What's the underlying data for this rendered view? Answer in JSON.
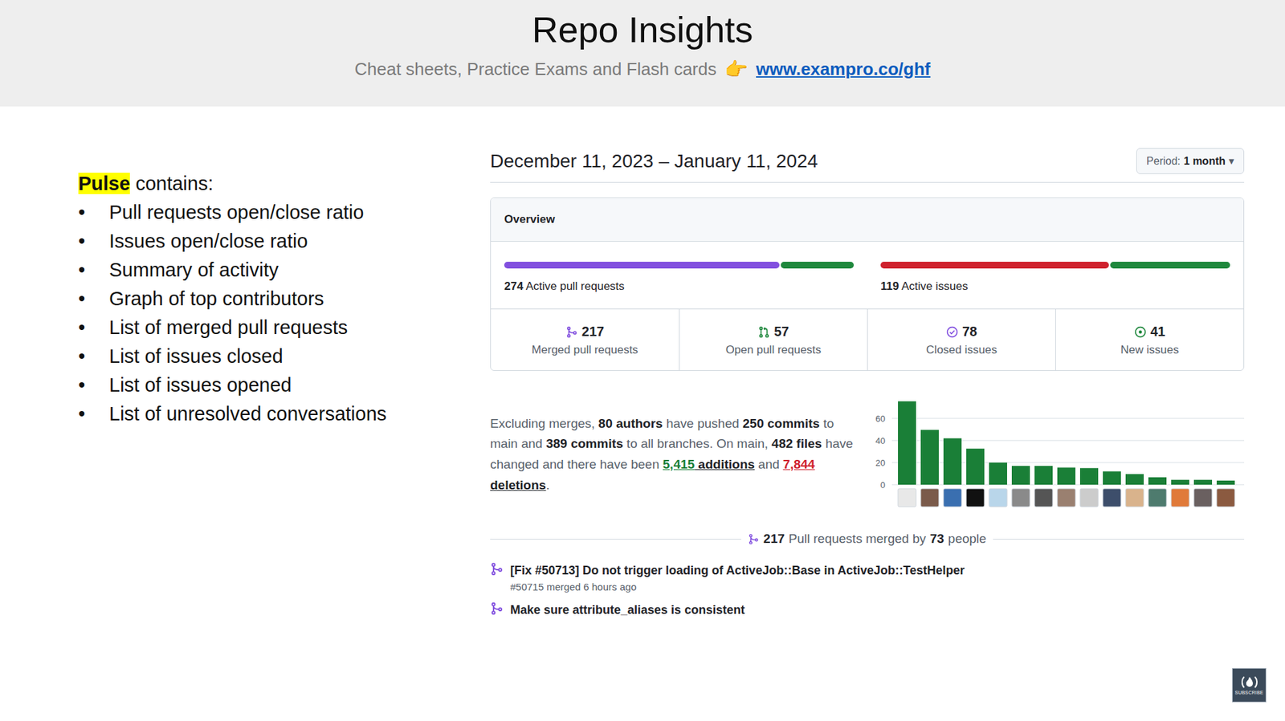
{
  "slide": {
    "title": "Repo Insights",
    "subtitle": "Cheat sheets, Practice Exams and Flash cards",
    "pointer": "👉",
    "link": "www.exampro.co/ghf"
  },
  "notes": {
    "highlight": "Pulse",
    "heading": " contains:",
    "bullet": "•",
    "items": [
      "Pull requests open/close ratio",
      "Issues open/close ratio",
      "Summary of activity",
      "Graph of top contributors",
      "List of merged pull requests",
      "List of issues closed",
      "List of issues opened",
      "List of unresolved conversations"
    ]
  },
  "pulse": {
    "date_range": "December 11, 2023 – January 11, 2024",
    "period": {
      "label": "Period:",
      "value": "1 month",
      "caret": "▾"
    },
    "overview": {
      "title": "Overview",
      "bars": [
        {
          "count": "274",
          "label": "Active pull requests",
          "segments": [
            {
              "level": 0.79,
              "color": "#8250df"
            },
            {
              "level": 0.21,
              "color": "#1f883d"
            }
          ]
        },
        {
          "count": "119",
          "label": "Active issues",
          "segments": [
            {
              "level": 0.655,
              "color": "#cf222e"
            },
            {
              "level": 0.345,
              "color": "#1f883d"
            }
          ]
        }
      ],
      "stats": [
        {
          "kind": "merged",
          "value": "217",
          "label": "Merged pull requests",
          "color": "#8250df"
        },
        {
          "kind": "open-pr",
          "value": "57",
          "label": "Open pull requests",
          "color": "#1f883d"
        },
        {
          "kind": "closed-issue",
          "value": "78",
          "label": "Closed issues",
          "color": "#8250df"
        },
        {
          "kind": "new-issue",
          "value": "41",
          "label": "New issues",
          "color": "#1f883d"
        }
      ]
    },
    "summary": [
      {
        "text": "Excluding merges, ",
        "kind": "plain"
      },
      {
        "text": "80 authors",
        "kind": "bold"
      },
      {
        "text": " have pushed ",
        "kind": "plain"
      },
      {
        "text": "250 commits",
        "kind": "bold"
      },
      {
        "text": " to main and ",
        "kind": "plain"
      },
      {
        "text": "389 commits",
        "kind": "bold"
      },
      {
        "text": " to all branches. On main, ",
        "kind": "plain"
      },
      {
        "text": "482 files",
        "kind": "bold"
      },
      {
        "text": " have changed and there have been ",
        "kind": "plain"
      },
      {
        "text": "5,415",
        "kind": "added"
      },
      {
        "text": " additions",
        "kind": "link"
      },
      {
        "text": " and ",
        "kind": "plain"
      },
      {
        "text": "7,844",
        "kind": "deleted"
      },
      {
        "text": " deletions",
        "kind": "link"
      },
      {
        "text": ".",
        "kind": "plain"
      }
    ],
    "chart": {
      "ticks": [
        "60",
        "40",
        "20",
        "0"
      ],
      "values": [
        75.5,
        49.6,
        42,
        32.6,
        20,
        17,
        17,
        15.5,
        15,
        12,
        9.6,
        6.7,
        4.4,
        4.4,
        3.7
      ]
    },
    "merged": {
      "count": "217",
      "text": "Pull requests merged by",
      "people": "73",
      "suffix": "people"
    },
    "pull_requests": [
      {
        "title": "[Fix #50713] Do not trigger loading of ActiveJob::Base in ActiveJob::TestHelper",
        "meta": "#50715 merged 6 hours ago"
      },
      {
        "title": "Make sure attribute_aliases is consistent"
      }
    ]
  },
  "badge": {
    "label": "SUBSCRIBE"
  }
}
